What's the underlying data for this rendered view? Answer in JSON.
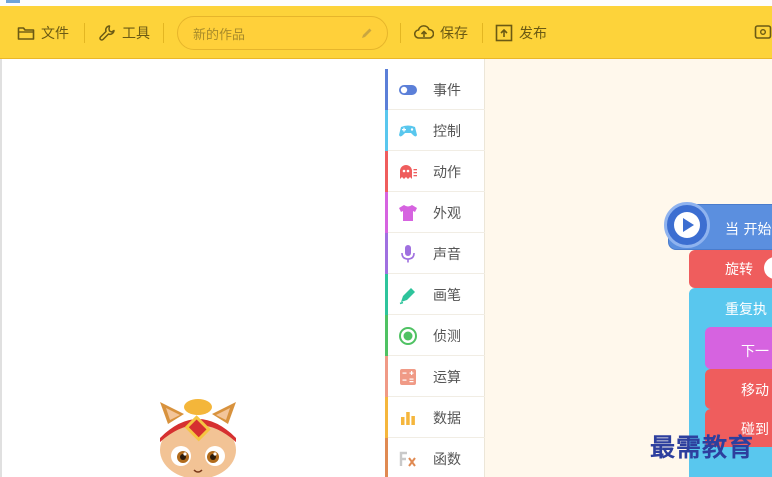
{
  "toolbar": {
    "file_label": "文件",
    "tools_label": "工具",
    "project_name": "新的作品",
    "save_label": "保存",
    "publish_label": "发布"
  },
  "categories": [
    {
      "label": "事件",
      "icon": "toggle-icon",
      "color": "#5b7fd8"
    },
    {
      "label": "控制",
      "icon": "gamepad-icon",
      "color": "#59c7ee"
    },
    {
      "label": "动作",
      "icon": "ghost-icon",
      "color": "#ef5d5d"
    },
    {
      "label": "外观",
      "icon": "tshirt-icon",
      "color": "#d663e0"
    },
    {
      "label": "声音",
      "icon": "microphone-icon",
      "color": "#a070e0"
    },
    {
      "label": "画笔",
      "icon": "pen-icon",
      "color": "#2ec49c"
    },
    {
      "label": "侦测",
      "icon": "radio-icon",
      "color": "#4fc263"
    },
    {
      "label": "运算",
      "icon": "calculator-icon",
      "color": "#f09a86"
    },
    {
      "label": "数据",
      "icon": "bar-chart-icon",
      "color": "#f5b63c"
    },
    {
      "label": "函数",
      "icon": "function-icon",
      "color": "#e08a52"
    }
  ],
  "blocks": {
    "when_start": "当 开始",
    "rotate": "旋转",
    "repeat": "重复执",
    "next": "下一",
    "move": "移动",
    "bounce": "碰到"
  },
  "watermark": "最需教育",
  "colors": {
    "toolbar_bg": "#fdd33a",
    "workspace_bg": "#fff8ec"
  }
}
